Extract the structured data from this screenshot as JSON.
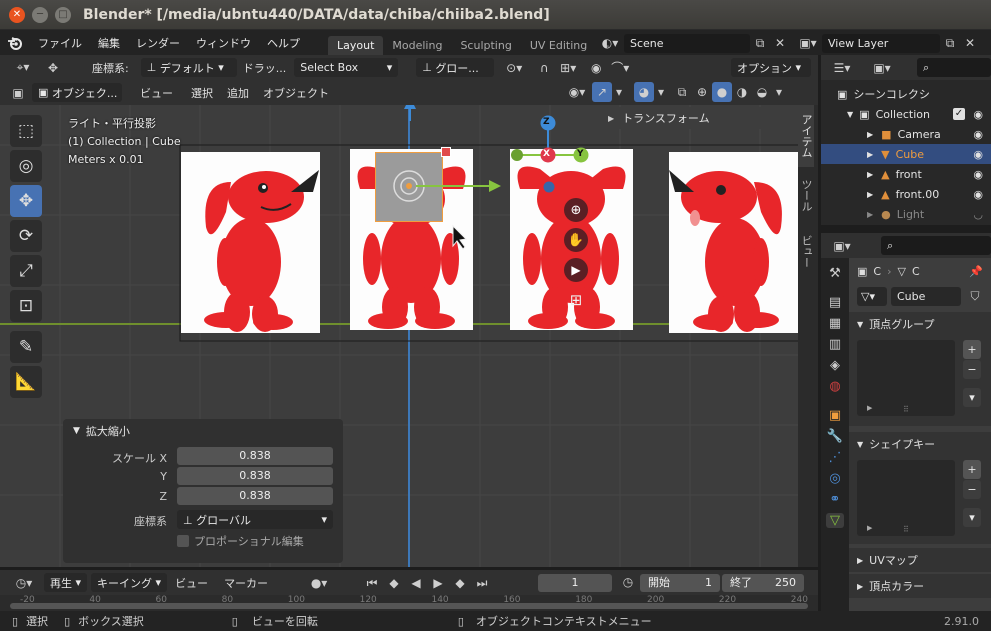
{
  "window": {
    "title": "Blender* [/media/ubntu440/DATA/data/chiba/chiiba2.blend]",
    "close": "✕",
    "minimize": "─",
    "maximize": "□"
  },
  "menubar": {
    "items": [
      "ファイル",
      "編集",
      "レンダー",
      "ウィンドウ",
      "ヘルプ"
    ],
    "workspaces": [
      "Layout",
      "Modeling",
      "Sculpting",
      "UV Editing",
      "-"
    ],
    "scene": "Scene",
    "view_layer": "View Layer"
  },
  "viewport_header": {
    "coord_label": "座標系:",
    "coord_value": "デフォルト",
    "drag_label": "ドラッ...",
    "drag_value": "Select Box",
    "orient_value": "グロー...",
    "options": "オプション"
  },
  "viewport_header2": {
    "mode": "オブジェク...",
    "menus": [
      "ビュー",
      "選択",
      "追加",
      "オブジェクト"
    ]
  },
  "overlay": {
    "line1": "ライト・平行投影",
    "line2": "(1) Collection | Cube",
    "line3": "Meters x 0.01"
  },
  "n_panel": {
    "header": "トランスフォーム",
    "tabs": [
      "アイテム",
      "ツール",
      "ビュー"
    ]
  },
  "gizmo": {
    "x": "X",
    "y": "Y",
    "z": "Z"
  },
  "operator_panel": {
    "title": "拡大縮小",
    "rows": [
      {
        "label": "スケール X",
        "value": "0.838"
      },
      {
        "label": "Y",
        "value": "0.838"
      },
      {
        "label": "Z",
        "value": "0.838"
      }
    ],
    "coord_label": "座標系",
    "coord_value": "グローバル",
    "proportional": "プロポーショナル編集"
  },
  "timeline": {
    "play_label": "再生",
    "keying_label": "キーイング",
    "view_label": "ビュー",
    "marker_label": "マーカー",
    "current_frame": "1",
    "start_label": "開始",
    "start": "1",
    "end_label": "終了",
    "end": "250",
    "ruler": [
      "-20",
      "40",
      "60",
      "80",
      "100",
      "120",
      "140",
      "160",
      "180",
      "200",
      "220",
      "240"
    ]
  },
  "statusbar": {
    "items": [
      "選択",
      "ボックス選択",
      "ビューを回転",
      "オブジェクトコンテキストメニュー"
    ],
    "version": "2.91.0"
  },
  "outliner": {
    "header": "シーンコレクシ",
    "collection": "Collection",
    "items": [
      {
        "name": "Camera",
        "icon": "camera-icon",
        "color": "#e08f3b"
      },
      {
        "name": "Cube",
        "icon": "mesh-icon",
        "color": "#e08f3b"
      },
      {
        "name": "front",
        "icon": "image-icon",
        "color": "#e08f3b"
      },
      {
        "name": "front.00",
        "icon": "image-icon",
        "color": "#e08f3b"
      },
      {
        "name": "Light",
        "icon": "light-icon",
        "color": "#b88850"
      }
    ]
  },
  "properties": {
    "crumb1": "C",
    "crumb2": "C",
    "object_name": "Cube",
    "sections": [
      "頂点グループ",
      "シェイプキー",
      "UVマップ",
      "頂点カラー"
    ],
    "add": "+",
    "remove": "−"
  },
  "colors": {
    "accent": "#4772b3",
    "orange": "#f09d3e",
    "x_axis": "#e0384b",
    "y_axis": "#87c43f",
    "z_axis": "#3d8bd8",
    "chiba_red": "#e8262a"
  }
}
